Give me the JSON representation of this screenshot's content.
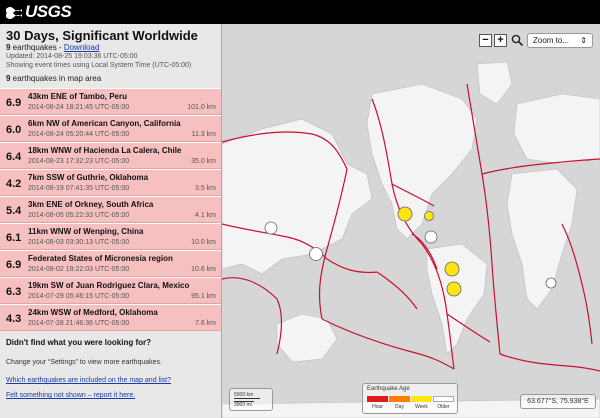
{
  "header": {
    "logo_text": "USGS"
  },
  "sidebar": {
    "title": "30 Days, Significant Worldwide",
    "count": "9",
    "count_suffix": " earthquakes - ",
    "download_label": "Download",
    "updated": "Updated: 2014-08-25 19:03:36 UTC-05:00",
    "timezone_note": "Showing event times using Local System Time (UTC-05:00)",
    "in_area_count": "9",
    "in_area_suffix": " earthquakes in map area",
    "earthquakes": [
      {
        "mag": "6.9",
        "place": "43km ENE of Tambo, Peru",
        "time": "2014-08-24 18:21:45 UTC-05:00",
        "depth": "101.0 km"
      },
      {
        "mag": "6.0",
        "place": "6km NW of American Canyon, California",
        "time": "2014-08-24 05:20:44 UTC-05:00",
        "depth": "11.3 km"
      },
      {
        "mag": "6.4",
        "place": "18km WNW of Hacienda La Calera, Chile",
        "time": "2014-08-23 17:32:23 UTC-05:00",
        "depth": "35.0 km"
      },
      {
        "mag": "4.2",
        "place": "7km SSW of Guthrie, Oklahoma",
        "time": "2014-08-19 07:41:35 UTC-05:00",
        "depth": "3.5 km"
      },
      {
        "mag": "5.4",
        "place": "3km ENE of Orkney, South Africa",
        "time": "2014-08-05 05:22:33 UTC-05:00",
        "depth": "4.1 km"
      },
      {
        "mag": "6.1",
        "place": "11km WNW of Wenping, China",
        "time": "2014-08-03 03:30:13 UTC-05:00",
        "depth": "10.0 km"
      },
      {
        "mag": "6.9",
        "place": "Federated States of Micronesia region",
        "time": "2014-08-02 19:22:03 UTC-05:00",
        "depth": "10.6 km"
      },
      {
        "mag": "6.3",
        "place": "19km SW of Juan Rodriguez Clara, Mexico",
        "time": "2014-07-29 05:46:15 UTC-05:00",
        "depth": "95.1 km"
      },
      {
        "mag": "4.3",
        "place": "24km WSW of Medford, Oklahoma",
        "time": "2014-07-28 21:46:36 UTC-05:00",
        "depth": "7.6 km"
      }
    ],
    "not_found_title": "Didn't find what you were looking for?",
    "settings_hint": "Change your “Settings” to view more earthquakes.",
    "included_link": "Which earthquakes are included on the map and list?",
    "report_link": "Felt something not shown – report it here."
  },
  "map": {
    "zoom_out_label": "−",
    "zoom_in_label": "+",
    "search_icon": "magnifier-icon",
    "zoom_select": "Zoom to...",
    "scale_km": "5000 km",
    "scale_mi": "3000 mi",
    "legend_title": "Earthquake Age",
    "legend": [
      {
        "label": "Hour",
        "color": "#e31a1c"
      },
      {
        "label": "Day",
        "color": "#ff7f00"
      },
      {
        "label": "Week",
        "color": "#ffe414"
      },
      {
        "label": "Older",
        "color": "#ffffff"
      }
    ],
    "coordinates": "63.677°S, 75.938°E"
  },
  "colors": {
    "list_bg": "#f7c0c0",
    "plate_line": "#c8102e",
    "land": "#f2f2f2",
    "ocean": "#d6d6d6"
  }
}
